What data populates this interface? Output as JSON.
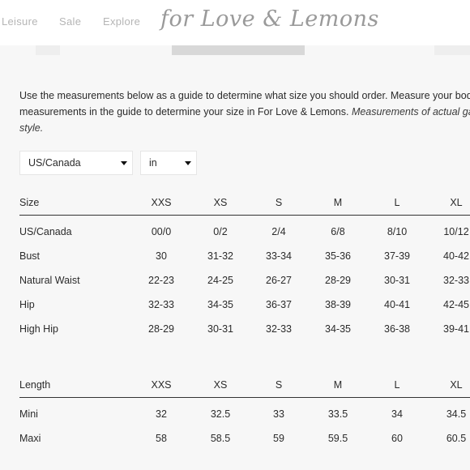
{
  "nav": {
    "links": [
      "Leisure",
      "Sale",
      "Explore"
    ],
    "logo": "for Love & Lemons"
  },
  "intro": {
    "line1": "Use the measurements below as a guide to determine what size you should order. Measure your body",
    "line2_plain": "measurements in the guide to determine your size in For Love & Lemons. ",
    "line2_italic": "Measurements of actual ga",
    "line3_italic": "style."
  },
  "controls": {
    "region": "US/Canada",
    "unit": "in"
  },
  "size_table": {
    "header_label": "Size",
    "sizes": [
      "XXS",
      "XS",
      "S",
      "M",
      "L",
      "XL"
    ],
    "rows": [
      {
        "label": "US/Canada",
        "values": [
          "00/0",
          "0/2",
          "2/4",
          "6/8",
          "8/10",
          "10/12"
        ]
      },
      {
        "label": "Bust",
        "values": [
          "30",
          "31-32",
          "33-34",
          "35-36",
          "37-39",
          "40-42"
        ]
      },
      {
        "label": "Natural Waist",
        "values": [
          "22-23",
          "24-25",
          "26-27",
          "28-29",
          "30-31",
          "32-33"
        ]
      },
      {
        "label": "Hip",
        "values": [
          "32-33",
          "34-35",
          "36-37",
          "38-39",
          "40-41",
          "42-45"
        ]
      },
      {
        "label": "High Hip",
        "values": [
          "28-29",
          "30-31",
          "32-33",
          "34-35",
          "36-38",
          "39-41"
        ]
      }
    ]
  },
  "length_table": {
    "header_label": "Length",
    "sizes": [
      "XXS",
      "XS",
      "S",
      "M",
      "L",
      "XL"
    ],
    "rows": [
      {
        "label": "Mini",
        "values": [
          "32",
          "32.5",
          "33",
          "33.5",
          "34",
          "34.5"
        ]
      },
      {
        "label": "Maxi",
        "values": [
          "58",
          "58.5",
          "59",
          "59.5",
          "60",
          "60.5"
        ]
      }
    ]
  }
}
